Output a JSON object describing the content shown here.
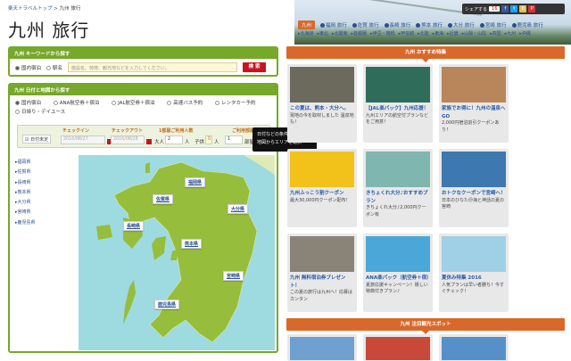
{
  "breadcrumb": {
    "home": "楽天トラベルトップ",
    "sep": ">",
    "current": "九州 旅行"
  },
  "page_title": "九州 旅行",
  "share": {
    "label": "シェアする",
    "count": "16"
  },
  "prefecture_nav": {
    "active": "九州",
    "items": [
      "福岡 旅行",
      "佐賀 旅行",
      "長崎 旅行",
      "熊本 旅行",
      "大分 旅行",
      "宮崎 旅行",
      "鹿児島 旅行"
    ]
  },
  "region_nav": [
    "北海道",
    "東北",
    "北関東",
    "首都圏",
    "伊豆・箱根",
    "甲信越",
    "北陸",
    "東海",
    "近畿",
    "山陽・山陰",
    "四国",
    "九州",
    "沖縄"
  ],
  "keyword_search": {
    "title": "九州 キーワードから探す",
    "radio_lodging": "国内宿泊",
    "radio_station": "駅名",
    "placeholder": "施設名、特徴、観光地などを入力してください。",
    "button": "検 索"
  },
  "map_search": {
    "title": "九州 日付と地図から探す",
    "options": [
      "国内宿泊",
      "ANA航空券＋宿泊",
      "JAL航空券＋宿泊",
      "高速バス予約",
      "レンタカー予約",
      "日帰り・デイユース"
    ],
    "undecided": "日付未定",
    "checkin_label": "チェックイン",
    "checkin": "2016/08/27",
    "checkout_label": "チェックアウト",
    "checkout": "2016/08/28",
    "guests_label": "1部屋ご利用人数",
    "adults_label": "大人",
    "adults": "2",
    "person": "人",
    "children_label": "子供",
    "children": "0",
    "rooms_label": "ご利用部屋数",
    "rooms": "1",
    "rooms_unit": "部屋",
    "prefectures": [
      "福岡県",
      "佐賀県",
      "長崎県",
      "熊本県",
      "大分県",
      "宮崎県",
      "鹿児島県"
    ]
  },
  "tooltip": {
    "line1": "日付などの条件を指定",
    "line2": "地図からエリアを選択"
  },
  "recommend": {
    "title": "九州 おすすめ特集",
    "cards": [
      {
        "title": "この夏は、熊本・大分へ。",
        "desc": "現地の今を取材しました 温泉地も！",
        "color": "#6b6a5c"
      },
      {
        "title": "【JAL楽パック】九州応援！",
        "desc": "九州エリアの航空付プランなどをご用意！",
        "color": "#2f6d5a"
      },
      {
        "title": "家族でお得に！九州の温泉へGO",
        "desc": "2,000円宿泊割引クーポンあり！",
        "color": "#b8865a"
      },
      {
        "title": "九州ふっこう割クーポン",
        "desc": "最大30,000円クーポン配布！",
        "color": "#f2c21a"
      },
      {
        "title": "きちょくれ大分♪おすすめプラン",
        "desc": "きちょくれ大分♪2,000円クーポン有",
        "color": "#7fb6b0"
      },
      {
        "title": "おトクなクーポンで宮崎へ！",
        "desc": "日本のひなた＠海と神話の夏の宮崎",
        "color": "#3d78b0"
      },
      {
        "title": "九州 無料宿泊券プレゼント！",
        "desc": "この夏の旅行は九州へ！応募はカンタン",
        "color": "#8a8478"
      },
      {
        "title": "ANA楽パック（航空券＋宿）",
        "desc": "夏旅応援キャンペーン！嬉しい特典付きプラン♪",
        "color": "#4aa7d8"
      },
      {
        "title": "夏休み特集 2016",
        "desc": "人気プランは早い者勝ち！今すぐチェック！",
        "color": "#9fd0e6"
      }
    ]
  },
  "spots": {
    "title": "九州 注目観光スポット"
  }
}
